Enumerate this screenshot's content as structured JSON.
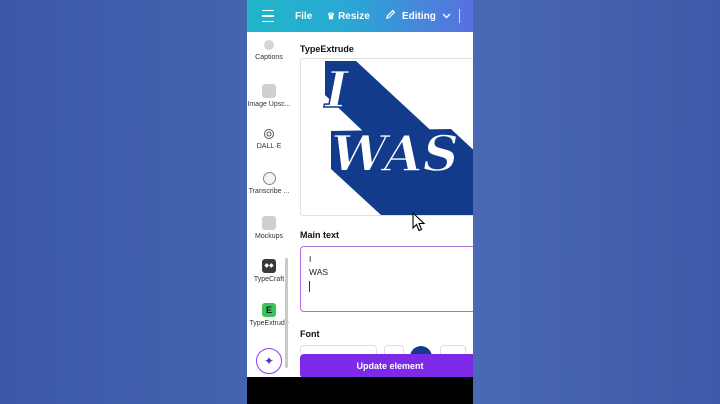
{
  "topbar": {
    "file_label": "File",
    "resize_label": "Resize",
    "editing_label": "Editing"
  },
  "sidebar": {
    "items": [
      {
        "label": "Captions",
        "icon": "captions-icon"
      },
      {
        "label": "Image Upsc...",
        "icon": "image-upscaler-icon"
      },
      {
        "label": "DALL·E",
        "icon": "dalle-icon"
      },
      {
        "label": "Transcribe ...",
        "icon": "transcribe-icon"
      },
      {
        "label": "Mockups",
        "icon": "mockups-icon"
      },
      {
        "label": "TypeCraft",
        "icon": "typecraft-icon"
      },
      {
        "label": "TypeExtrude",
        "icon": "typeextrude-icon"
      }
    ]
  },
  "app": {
    "title": "TypeExtrude",
    "preview_text_line1": "I",
    "preview_text_line2": "WAS",
    "main_text_label": "Main text",
    "main_text_value_line1": "I",
    "main_text_value_line2": "WAS",
    "font_label": "Font",
    "update_button_label": "Update element"
  },
  "colors": {
    "brand_purple": "#7d2ae8",
    "extrude_navy": "#123b8c",
    "topbar_start": "#1fb6c9",
    "topbar_end": "#5a6fe0"
  }
}
